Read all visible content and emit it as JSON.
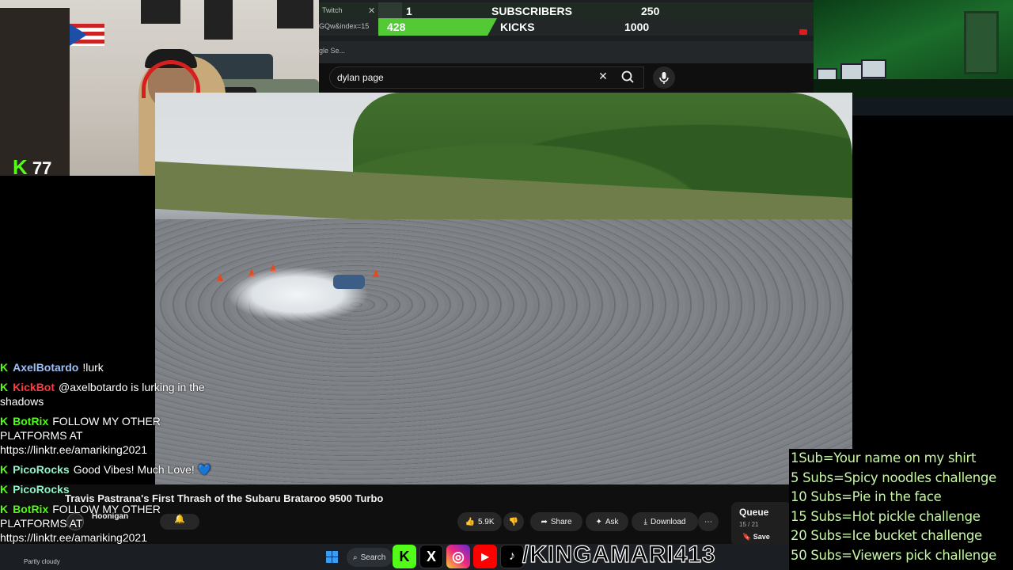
{
  "overlay": {
    "kick_count": "77",
    "goal_bar": {
      "tab_label": "Twitch",
      "url_fragment": "GQw&index=15",
      "search_tab_fragment": "gle Se...",
      "subscribers": {
        "current": "1",
        "label": "SUBSCRIBERS",
        "target": "250"
      },
      "kicks": {
        "current": "428",
        "label": "KICKS",
        "target": "1000"
      }
    }
  },
  "youtube": {
    "search": {
      "value": "dylan page"
    },
    "video": {
      "title": "Travis Pastrana's First Thrash of the Subaru Brataroo 9500 Turbo",
      "channel": "Hoonigan"
    },
    "actions": {
      "like_count": "5.9K",
      "share": "Share",
      "ask": "Ask",
      "download": "Download"
    },
    "queue": {
      "title": "Queue",
      "count": "15 / 21",
      "save": "Save"
    }
  },
  "chat": [
    {
      "user": "AxelBotardo",
      "color": "#9fc0f6",
      "text": "!lurk"
    },
    {
      "user": "KickBot",
      "color": "#ff3b3b",
      "text": "@axelbotardo is lurking in the shadows"
    },
    {
      "user": "BotRix",
      "color": "#53fc18",
      "text": "FOLLOW MY OTHER PLATFORMS AT https://linktr.ee/amariking2021"
    },
    {
      "user": "PicoRocks",
      "color": "#8ff5c8",
      "text": "Good Vibes! Much Love! 💙"
    },
    {
      "user": "PicoRocks",
      "color": "#8ff5c8",
      "text": ""
    },
    {
      "user": "BotRix",
      "color": "#53fc18",
      "text": "FOLLOW MY OTHER PLATFORMS AT https://linktr.ee/amariking2021"
    }
  ],
  "goals": [
    "1Sub=Your name on my shirt",
    "5 Subs=Spicy noodles challenge",
    "10 Subs=Pie in the face",
    "15 Subs=Hot pickle challenge",
    "20 Subs=Ice bucket challenge",
    "50 Subs=Viewers pick challenge"
  ],
  "taskbar": {
    "weather": "Partly cloudy",
    "search": "Search"
  },
  "socials": {
    "handle": "/KINGAMARI413",
    "tiktok": "TikTok"
  }
}
